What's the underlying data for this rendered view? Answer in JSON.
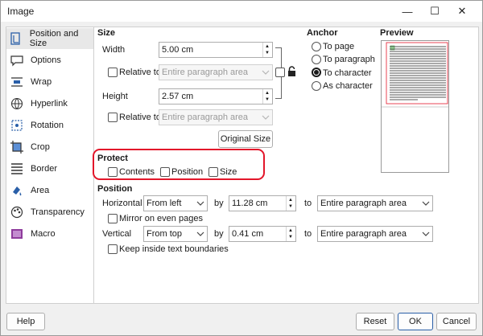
{
  "window": {
    "title": "Image",
    "minimize": "—",
    "maximize": "☐",
    "close": "✕"
  },
  "sidebar": {
    "items": [
      {
        "label": "Position and Size",
        "icon": "position-size-icon"
      },
      {
        "label": "Options",
        "icon": "options-icon"
      },
      {
        "label": "Wrap",
        "icon": "wrap-icon"
      },
      {
        "label": "Hyperlink",
        "icon": "hyperlink-icon"
      },
      {
        "label": "Rotation",
        "icon": "rotation-icon"
      },
      {
        "label": "Crop",
        "icon": "crop-icon"
      },
      {
        "label": "Border",
        "icon": "border-icon"
      },
      {
        "label": "Area",
        "icon": "area-icon"
      },
      {
        "label": "Transparency",
        "icon": "transparency-icon"
      },
      {
        "label": "Macro",
        "icon": "macro-icon"
      }
    ]
  },
  "size": {
    "title": "Size",
    "width_label": "Width",
    "width_value": "5.00 cm",
    "relative_label": "Relative to",
    "width_relative": "Entire paragraph area",
    "height_label": "Height",
    "height_value": "2.57 cm",
    "height_relative": "Entire paragraph area",
    "original_size": "Original Size"
  },
  "anchor": {
    "title": "Anchor",
    "options": [
      "To page",
      "To paragraph",
      "To character",
      "As character"
    ],
    "selected": "To character"
  },
  "preview": {
    "title": "Preview"
  },
  "protect": {
    "title": "Protect",
    "contents": "Contents",
    "position": "Position",
    "size": "Size"
  },
  "position": {
    "title": "Position",
    "horizontal_label": "Horizontal",
    "horizontal_mode": "From left",
    "by_label": "by",
    "horizontal_by": "11.28 cm",
    "to_label": "to",
    "horizontal_to": "Entire paragraph area",
    "mirror_label": "Mirror on even pages",
    "vertical_label": "Vertical",
    "vertical_mode": "From top",
    "vertical_by": "0.41 cm",
    "vertical_to": "Entire paragraph area",
    "keep_inside_label": "Keep inside text boundaries"
  },
  "buttons": {
    "help": "Help",
    "reset": "Reset",
    "ok": "OK",
    "cancel": "Cancel"
  }
}
